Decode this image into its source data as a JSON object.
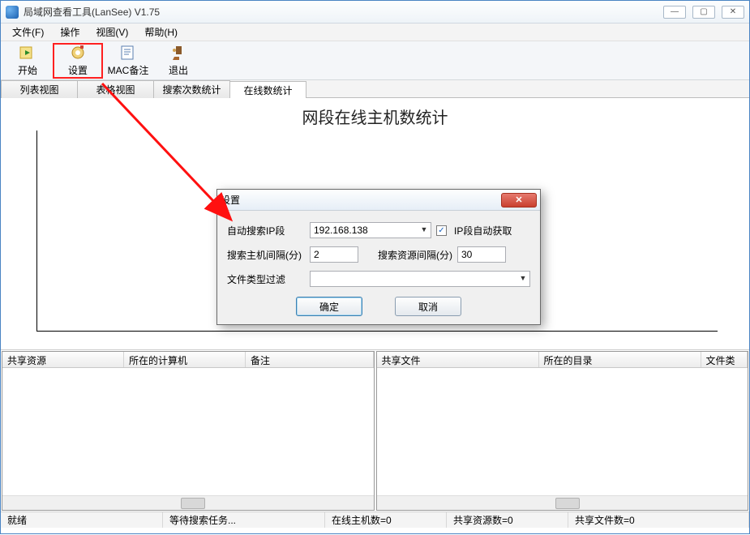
{
  "window": {
    "title": "局域网查看工具(LanSee) V1.75"
  },
  "menu": {
    "file": "文件(F)",
    "operate": "操作",
    "view": "视图(V)",
    "help": "帮助(H)"
  },
  "toolbar": {
    "start": "开始",
    "settings": "设置",
    "mac": "MAC备注",
    "exit": "退出"
  },
  "tabs": {
    "list": "列表视图",
    "table": "表格视图",
    "search_stats": "搜索次数统计",
    "online_stats": "在线数统计"
  },
  "chart": {
    "title": "网段在线主机数统计"
  },
  "panels": {
    "left": {
      "col1": "共享资源",
      "col2": "所在的计算机",
      "col3": "备注"
    },
    "right": {
      "col1": "共享文件",
      "col2": "所在的目录",
      "col3": "文件类"
    }
  },
  "status": {
    "ready": "就绪",
    "waiting": "等待搜索任务...",
    "hosts": "在线主机数=0",
    "shares": "共享资源数=0",
    "files": "共享文件数=0"
  },
  "dialog": {
    "title": "设置",
    "auto_ip_label": "自动搜索IP段",
    "ip_value": "192.168.138",
    "auto_get_label": "IP段自动获取",
    "host_interval_label": "搜索主机间隔(分)",
    "host_interval_value": "2",
    "res_interval_label": "搜索资源间隔(分)",
    "res_interval_value": "30",
    "file_filter_label": "文件类型过滤",
    "file_filter_value": "",
    "ok": "确定",
    "cancel": "取消"
  },
  "chart_data": {
    "type": "bar",
    "title": "网段在线主机数统计",
    "categories": [],
    "values": [],
    "xlabel": "",
    "ylabel": "",
    "ylim": [
      0,
      0
    ]
  }
}
